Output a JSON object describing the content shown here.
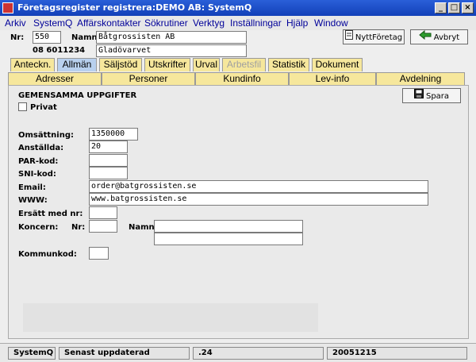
{
  "window": {
    "title": "Företagsregister registrera:DEMO AB: SystemQ"
  },
  "menu": [
    "Arkiv",
    "SystemQ",
    "Affärskontakter",
    "Sökrutiner",
    "Verktyg",
    "Inställningar",
    "Hjälp",
    "Window"
  ],
  "header": {
    "nr_label": "Nr:",
    "nr_value": "550",
    "namn_label": "Namn:",
    "namn_value": "Båtgrossisten AB",
    "phone": "08 6011234",
    "ort": "Gladövarvet"
  },
  "buttons": {
    "new_company": "NyttFöretag",
    "cancel": "Avbryt",
    "save": "Spara"
  },
  "tabs": [
    "Anteckn.",
    "Allmän",
    "Säljstöd",
    "Utskrifter",
    "Urval",
    "Arbetsfil",
    "Statistik",
    "Dokument"
  ],
  "subtabs": [
    "Adresser",
    "Personer",
    "Kundinfo",
    "Lev-info",
    "Avdelning"
  ],
  "form": {
    "section_title": "GEMENSAMMA UPPGIFTER",
    "privat_label": "Privat",
    "omsattning_label": "Omsättning:",
    "omsattning_value": "1350000",
    "anstallda_label": "Anställda:",
    "anstallda_value": "20",
    "par_label": "PAR-kod:",
    "par_value": "",
    "sni_label": "SNI-kod:",
    "sni_value": "",
    "email_label": "Email:",
    "email_value": "order@batgrossisten.se",
    "www_label": "WWW:",
    "www_value": "www.batgrossisten.se",
    "ersatt_label": "Ersätt med nr:",
    "ersatt_value": "",
    "koncern_label": "Koncern:",
    "koncern_nr_label": "Nr:",
    "koncern_nr_value": "",
    "koncern_namn_label": "Namn:",
    "koncern_namn_value": "",
    "koncern_namn2_value": "",
    "kommunkod_label": "Kommunkod:",
    "kommunkod_value": ""
  },
  "status": {
    "app": "SystemQ",
    "updated_label": "Senast uppdaterad",
    "version": ".24",
    "date": "20051215"
  }
}
